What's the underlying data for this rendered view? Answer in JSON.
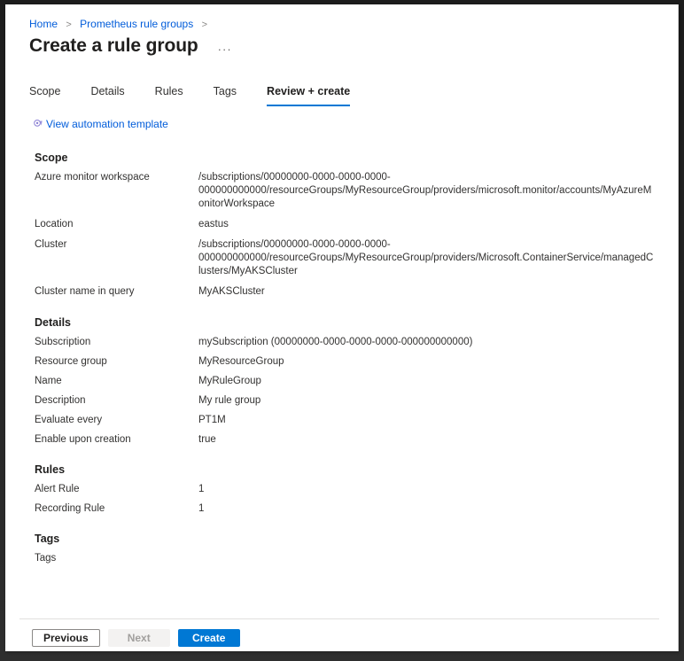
{
  "breadcrumb": {
    "items": [
      {
        "label": "Home"
      },
      {
        "label": "Prometheus rule groups"
      }
    ],
    "separator": ">"
  },
  "header": {
    "title": "Create a rule group",
    "ellipsis_label": "···"
  },
  "tabs": [
    {
      "label": "Scope",
      "active": false
    },
    {
      "label": "Details",
      "active": false
    },
    {
      "label": "Rules",
      "active": false
    },
    {
      "label": "Tags",
      "active": false
    },
    {
      "label": "Review + create",
      "active": true
    }
  ],
  "automation_link": {
    "label": "View automation template",
    "icon": "automation-template-icon"
  },
  "sections": [
    {
      "id": "scope",
      "title": "Scope",
      "rows": [
        {
          "label": "Azure monitor workspace",
          "value_lines": [
            "/subscriptions/00000000-0000-0000-0000-",
            "000000000000/resourceGroups/MyResourceGroup/providers/microsoft.monitor/accounts/MyAzureMonitorWorkspace"
          ]
        },
        {
          "label": "Location",
          "value_lines": [
            "eastus"
          ]
        },
        {
          "label": "Cluster",
          "value_lines": [
            "/subscriptions/00000000-0000-0000-0000-",
            "000000000000/resourceGroups/MyResourceGroup/providers/Microsoft.ContainerService/managedClusters/MyAKSCluster"
          ]
        },
        {
          "label": "Cluster name in query",
          "value_lines": [
            "MyAKSCluster"
          ]
        }
      ]
    },
    {
      "id": "details",
      "title": "Details",
      "rows": [
        {
          "label": "Subscription",
          "value_lines": [
            "mySubscription (00000000-0000-0000-0000-000000000000)"
          ]
        },
        {
          "label": "Resource group",
          "value_lines": [
            "MyResourceGroup"
          ]
        },
        {
          "label": "Name",
          "value_lines": [
            "MyRuleGroup"
          ]
        },
        {
          "label": "Description",
          "value_lines": [
            "My rule group"
          ]
        },
        {
          "label": "Evaluate every",
          "value_lines": [
            "PT1M"
          ]
        },
        {
          "label": "Enable upon creation",
          "value_lines": [
            "true"
          ]
        }
      ]
    },
    {
      "id": "rules",
      "title": "Rules",
      "rows": [
        {
          "label": "Alert Rule",
          "value_lines": [
            "1"
          ]
        },
        {
          "label": "Recording Rule",
          "value_lines": [
            "1"
          ]
        }
      ]
    },
    {
      "id": "tags",
      "title": "Tags",
      "rows": [
        {
          "label": "Tags",
          "value_lines": [
            ""
          ]
        }
      ]
    }
  ],
  "footer": {
    "previous_label": "Previous",
    "next_label": "Next",
    "create_label": "Create"
  },
  "colors": {
    "accent": "#0078d4",
    "link": "#015cda",
    "text": "#323130",
    "heading": "#201f1e",
    "disabled_text": "#a19f9d",
    "divider": "#e1dfdd"
  }
}
